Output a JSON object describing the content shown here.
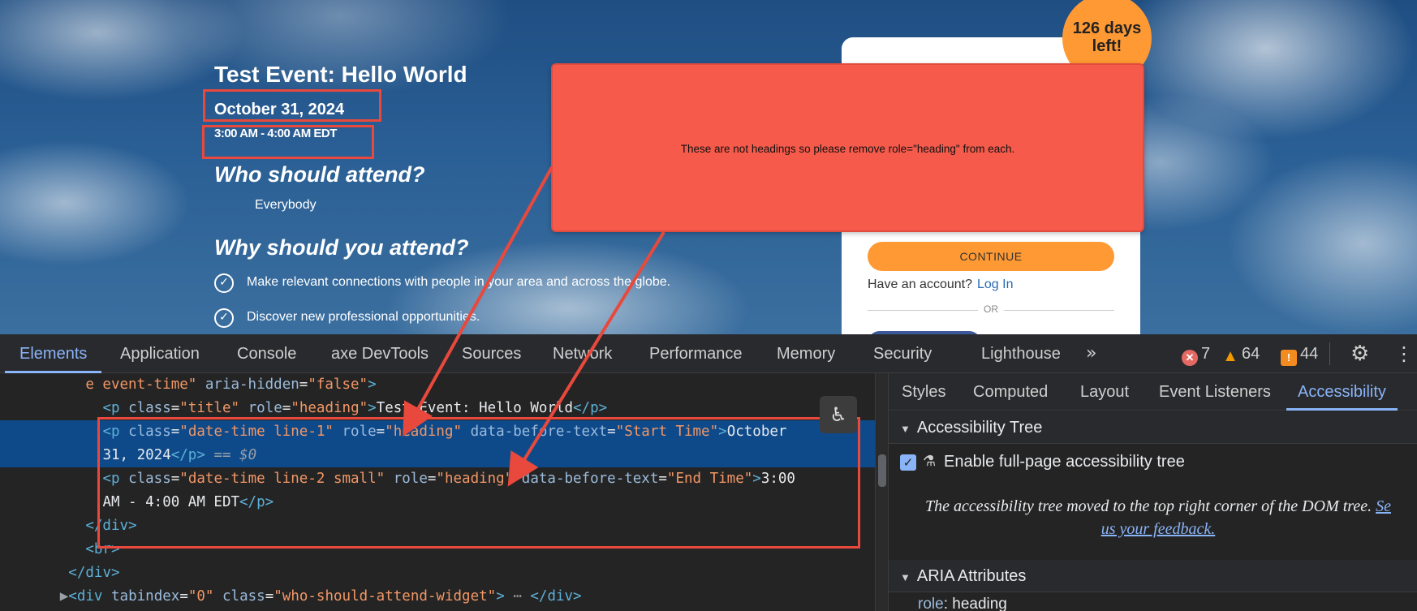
{
  "event": {
    "title": "Test Event: Hello World",
    "date": "October 31, 2024",
    "time": "3:00 AM - 4:00 AM EDT",
    "who_heading": "Who should attend?",
    "who_body": "Everybody",
    "why_heading": "Why should you attend?",
    "reasons": [
      "Make relevant connections with people in your area and across the globe.",
      "Discover new professional opportunities."
    ]
  },
  "signup": {
    "days_left": "126 days left!",
    "continue_label": "CONTINUE",
    "have_account": "Have an account?",
    "login_label": "Log In",
    "or_label": "OR"
  },
  "annotation": {
    "callout_text": "These are not headings so please remove role=\"heading\" from each.",
    "color": "#f55a4b"
  },
  "devtools": {
    "tabs": [
      "Elements",
      "Application",
      "Console",
      "axe DevTools",
      "Sources",
      "Network",
      "Performance",
      "Memory",
      "Security",
      "Lighthouse"
    ],
    "active_tab": "Elements",
    "errors": "7",
    "warnings": "64",
    "issues": "44",
    "side_tabs": [
      "Styles",
      "Computed",
      "Layout",
      "Event Listeners",
      "Accessibility"
    ],
    "active_side_tab": "Accessibility",
    "accessibility_tree_header": "Accessibility Tree",
    "enable_tree_label": "Enable full-page accessibility tree",
    "tree_note_line1": "The accessibility tree moved to the top right corner of the DOM tree.",
    "tree_note_link": "Se",
    "tree_note_line2": "us your feedback.",
    "aria_header": "ARIA Attributes",
    "aria_key": "role",
    "aria_value": "heading",
    "code": {
      "l1_attr_frag": "e event-time\"",
      "l1_attr": "aria-hidden",
      "l1_val": "\"false\"",
      "l2_class": "\"title\"",
      "l2_role": "\"heading\"",
      "l2_text": "Test Event: Hello World",
      "l3_class": "\"date-time line-1\"",
      "l3_role": "\"heading\"",
      "l3_before": "\"Start Time\"",
      "l3_text": "October",
      "l4_text": "31, 2024",
      "l4_ret": "== $0",
      "l5_class": "\"date-time line-2 small\"",
      "l5_role": "\"heading\"",
      "l5_before": "\"End Time\"",
      "l5_text": "3:00",
      "l6_text": "AM - 4:00 AM EDT",
      "l10_class": "\"who-should-attend-widget\"",
      "l10_tabindex": "\"0\""
    }
  }
}
